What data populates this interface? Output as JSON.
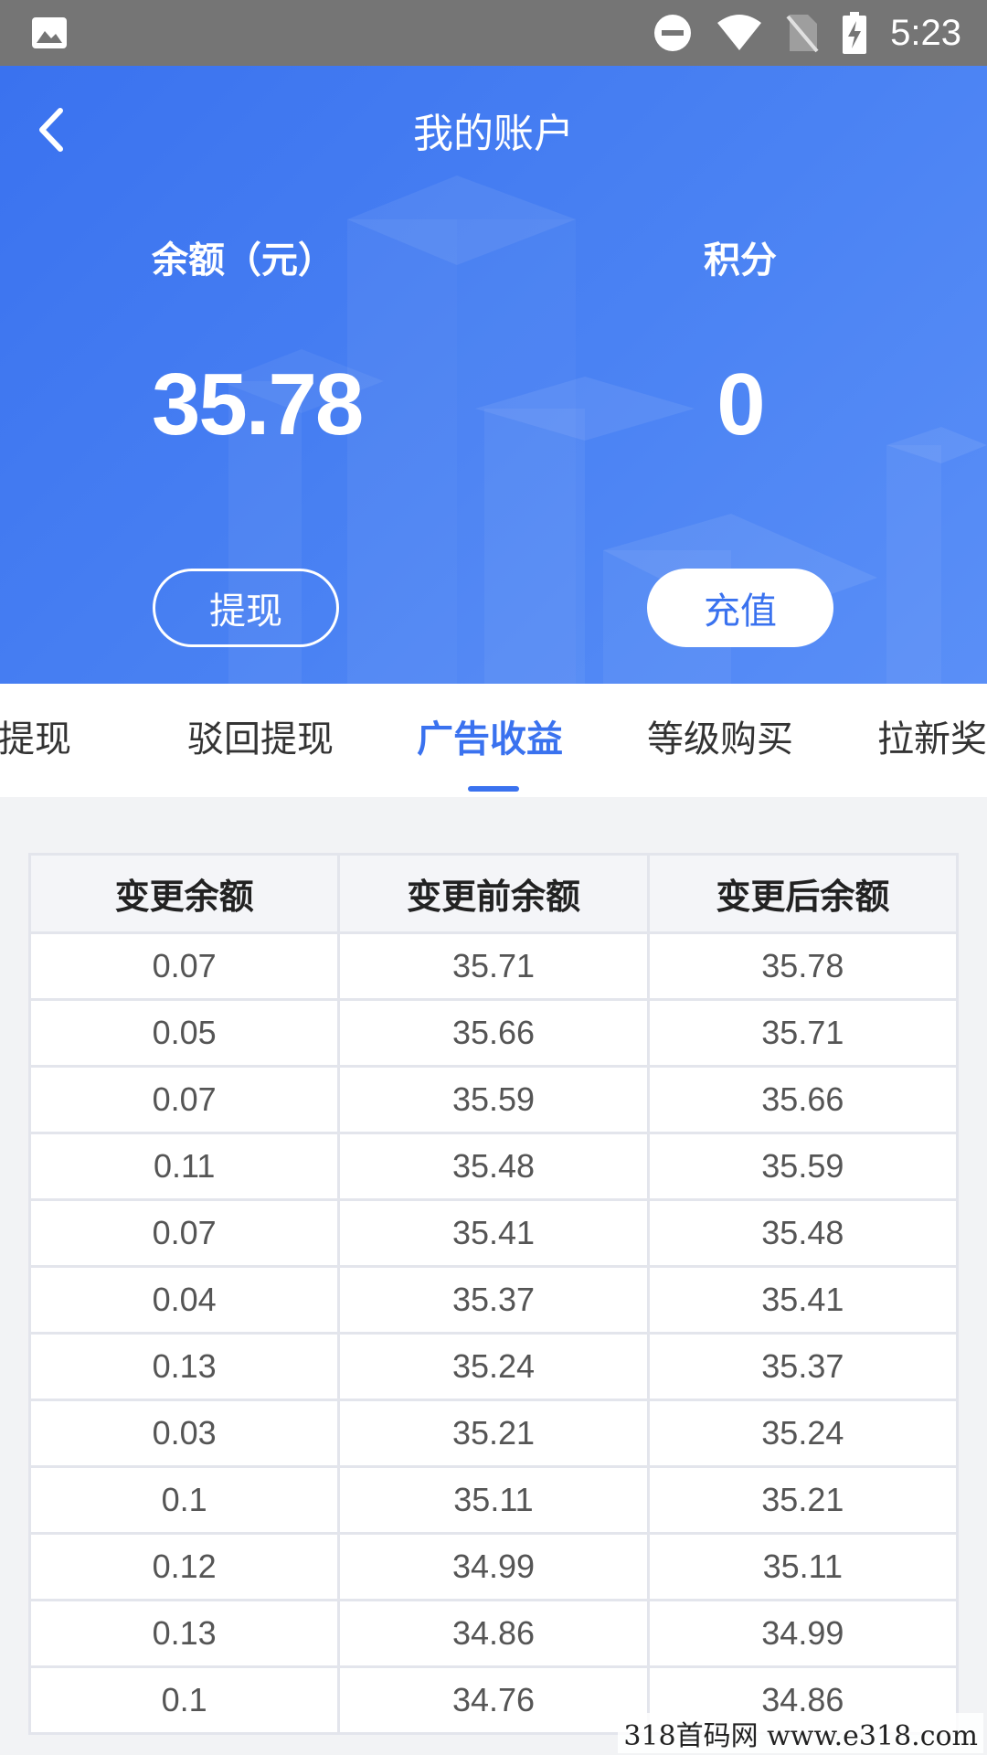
{
  "status_bar": {
    "time": "5:23",
    "left_icon": "image-icon",
    "right_icons": [
      "dnd-icon",
      "wifi-icon",
      "no-sim-icon",
      "battery-charging-icon"
    ]
  },
  "header": {
    "title": "我的账户",
    "back_icon": "chevron-left-icon",
    "colors": {
      "gradient_start": "#3a72ef",
      "gradient_end": "#5a8ff7"
    }
  },
  "balance": {
    "label": "余额（元）",
    "value": "35.78"
  },
  "points": {
    "label": "积分",
    "value": "0"
  },
  "actions": {
    "withdraw_label": "提现",
    "recharge_label": "充值"
  },
  "tabs": [
    {
      "label": "户提现",
      "active": false
    },
    {
      "label": "驳回提现",
      "active": false
    },
    {
      "label": "广告收益",
      "active": true
    },
    {
      "label": "等级购买",
      "active": false
    },
    {
      "label": "拉新奖",
      "active": false
    }
  ],
  "table": {
    "headers": [
      "变更余额",
      "变更前余额",
      "变更后余额"
    ],
    "rows": [
      [
        "0.07",
        "35.71",
        "35.78"
      ],
      [
        "0.05",
        "35.66",
        "35.71"
      ],
      [
        "0.07",
        "35.59",
        "35.66"
      ],
      [
        "0.11",
        "35.48",
        "35.59"
      ],
      [
        "0.07",
        "35.41",
        "35.48"
      ],
      [
        "0.04",
        "35.37",
        "35.41"
      ],
      [
        "0.13",
        "35.24",
        "35.37"
      ],
      [
        "0.03",
        "35.21",
        "35.24"
      ],
      [
        "0.1",
        "35.11",
        "35.21"
      ],
      [
        "0.12",
        "34.99",
        "35.11"
      ],
      [
        "0.13",
        "34.86",
        "34.99"
      ],
      [
        "0.1",
        "34.76",
        "34.86"
      ]
    ]
  },
  "watermark": "318首码网 www.e318.com",
  "accent_color": "#3a72ef"
}
